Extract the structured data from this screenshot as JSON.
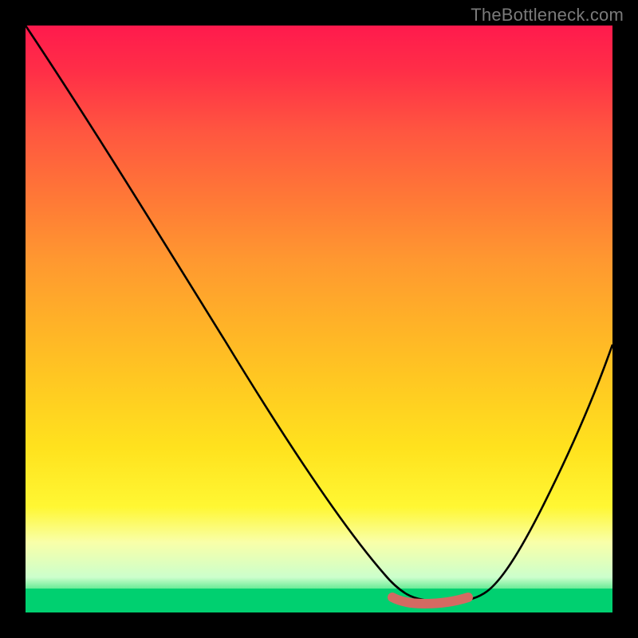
{
  "watermark": "TheBottleneck.com",
  "chart_data": {
    "type": "line",
    "title": "",
    "xlabel": "",
    "ylabel": "",
    "xlim": [
      0,
      100
    ],
    "ylim": [
      0,
      100
    ],
    "grid": false,
    "legend": false,
    "series": [
      {
        "name": "bottleneck-curve",
        "x": [
          0,
          10,
          20,
          30,
          40,
          50,
          60,
          63,
          66,
          70,
          75,
          80,
          85,
          90,
          95,
          100
        ],
        "values": [
          100,
          86,
          71,
          56,
          41,
          26,
          11,
          4,
          1,
          0,
          0,
          4,
          14,
          26,
          40,
          55
        ]
      },
      {
        "name": "optimal-range-highlight",
        "x": [
          63,
          75
        ],
        "values": [
          1,
          1
        ]
      }
    ],
    "background_gradient": {
      "top": "#ff1a4d",
      "mid": "#ffd31f",
      "bottom": "#00d070"
    },
    "highlight_color": "#d46a62",
    "curve_color": "#000000"
  }
}
